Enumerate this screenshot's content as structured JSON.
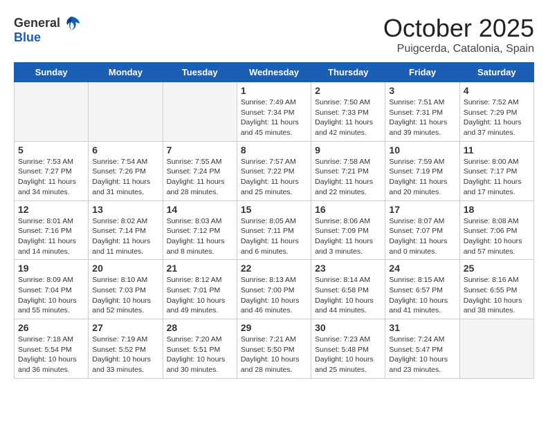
{
  "header": {
    "logo_general": "General",
    "logo_blue": "Blue",
    "month_title": "October 2025",
    "location": "Puigcerda, Catalonia, Spain"
  },
  "days_of_week": [
    "Sunday",
    "Monday",
    "Tuesday",
    "Wednesday",
    "Thursday",
    "Friday",
    "Saturday"
  ],
  "weeks": [
    [
      {
        "day": "",
        "info": ""
      },
      {
        "day": "",
        "info": ""
      },
      {
        "day": "",
        "info": ""
      },
      {
        "day": "1",
        "info": "Sunrise: 7:49 AM\nSunset: 7:34 PM\nDaylight: 11 hours and 45 minutes."
      },
      {
        "day": "2",
        "info": "Sunrise: 7:50 AM\nSunset: 7:33 PM\nDaylight: 11 hours and 42 minutes."
      },
      {
        "day": "3",
        "info": "Sunrise: 7:51 AM\nSunset: 7:31 PM\nDaylight: 11 hours and 39 minutes."
      },
      {
        "day": "4",
        "info": "Sunrise: 7:52 AM\nSunset: 7:29 PM\nDaylight: 11 hours and 37 minutes."
      }
    ],
    [
      {
        "day": "5",
        "info": "Sunrise: 7:53 AM\nSunset: 7:27 PM\nDaylight: 11 hours and 34 minutes."
      },
      {
        "day": "6",
        "info": "Sunrise: 7:54 AM\nSunset: 7:26 PM\nDaylight: 11 hours and 31 minutes."
      },
      {
        "day": "7",
        "info": "Sunrise: 7:55 AM\nSunset: 7:24 PM\nDaylight: 11 hours and 28 minutes."
      },
      {
        "day": "8",
        "info": "Sunrise: 7:57 AM\nSunset: 7:22 PM\nDaylight: 11 hours and 25 minutes."
      },
      {
        "day": "9",
        "info": "Sunrise: 7:58 AM\nSunset: 7:21 PM\nDaylight: 11 hours and 22 minutes."
      },
      {
        "day": "10",
        "info": "Sunrise: 7:59 AM\nSunset: 7:19 PM\nDaylight: 11 hours and 20 minutes."
      },
      {
        "day": "11",
        "info": "Sunrise: 8:00 AM\nSunset: 7:17 PM\nDaylight: 11 hours and 17 minutes."
      }
    ],
    [
      {
        "day": "12",
        "info": "Sunrise: 8:01 AM\nSunset: 7:16 PM\nDaylight: 11 hours and 14 minutes."
      },
      {
        "day": "13",
        "info": "Sunrise: 8:02 AM\nSunset: 7:14 PM\nDaylight: 11 hours and 11 minutes."
      },
      {
        "day": "14",
        "info": "Sunrise: 8:03 AM\nSunset: 7:12 PM\nDaylight: 11 hours and 8 minutes."
      },
      {
        "day": "15",
        "info": "Sunrise: 8:05 AM\nSunset: 7:11 PM\nDaylight: 11 hours and 6 minutes."
      },
      {
        "day": "16",
        "info": "Sunrise: 8:06 AM\nSunset: 7:09 PM\nDaylight: 11 hours and 3 minutes."
      },
      {
        "day": "17",
        "info": "Sunrise: 8:07 AM\nSunset: 7:07 PM\nDaylight: 11 hours and 0 minutes."
      },
      {
        "day": "18",
        "info": "Sunrise: 8:08 AM\nSunset: 7:06 PM\nDaylight: 10 hours and 57 minutes."
      }
    ],
    [
      {
        "day": "19",
        "info": "Sunrise: 8:09 AM\nSunset: 7:04 PM\nDaylight: 10 hours and 55 minutes."
      },
      {
        "day": "20",
        "info": "Sunrise: 8:10 AM\nSunset: 7:03 PM\nDaylight: 10 hours and 52 minutes."
      },
      {
        "day": "21",
        "info": "Sunrise: 8:12 AM\nSunset: 7:01 PM\nDaylight: 10 hours and 49 minutes."
      },
      {
        "day": "22",
        "info": "Sunrise: 8:13 AM\nSunset: 7:00 PM\nDaylight: 10 hours and 46 minutes."
      },
      {
        "day": "23",
        "info": "Sunrise: 8:14 AM\nSunset: 6:58 PM\nDaylight: 10 hours and 44 minutes."
      },
      {
        "day": "24",
        "info": "Sunrise: 8:15 AM\nSunset: 6:57 PM\nDaylight: 10 hours and 41 minutes."
      },
      {
        "day": "25",
        "info": "Sunrise: 8:16 AM\nSunset: 6:55 PM\nDaylight: 10 hours and 38 minutes."
      }
    ],
    [
      {
        "day": "26",
        "info": "Sunrise: 7:18 AM\nSunset: 5:54 PM\nDaylight: 10 hours and 36 minutes."
      },
      {
        "day": "27",
        "info": "Sunrise: 7:19 AM\nSunset: 5:52 PM\nDaylight: 10 hours and 33 minutes."
      },
      {
        "day": "28",
        "info": "Sunrise: 7:20 AM\nSunset: 5:51 PM\nDaylight: 10 hours and 30 minutes."
      },
      {
        "day": "29",
        "info": "Sunrise: 7:21 AM\nSunset: 5:50 PM\nDaylight: 10 hours and 28 minutes."
      },
      {
        "day": "30",
        "info": "Sunrise: 7:23 AM\nSunset: 5:48 PM\nDaylight: 10 hours and 25 minutes."
      },
      {
        "day": "31",
        "info": "Sunrise: 7:24 AM\nSunset: 5:47 PM\nDaylight: 10 hours and 23 minutes."
      },
      {
        "day": "",
        "info": ""
      }
    ]
  ]
}
